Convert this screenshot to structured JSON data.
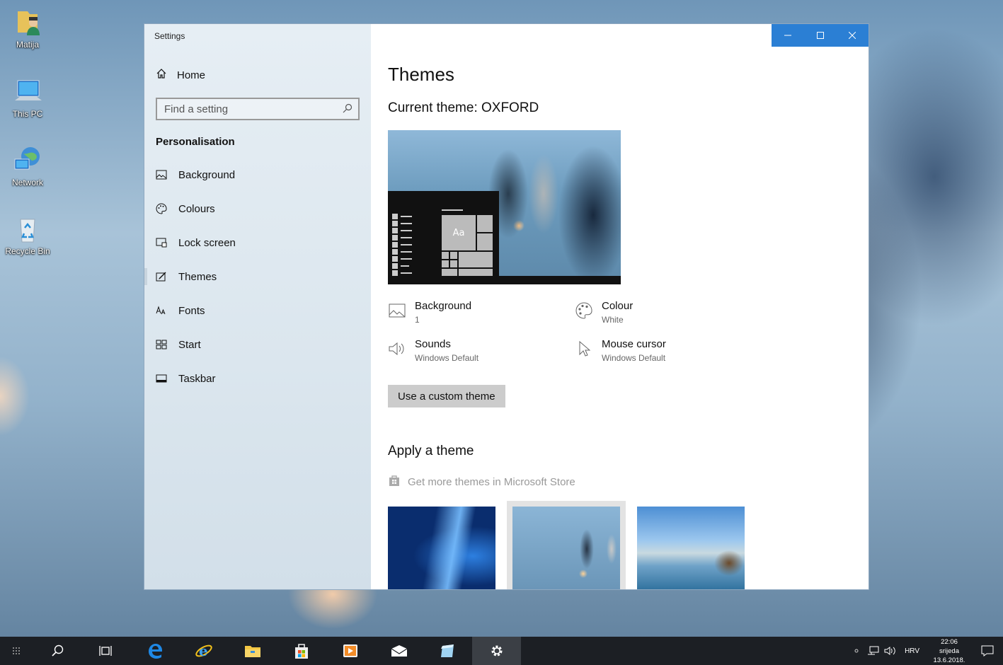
{
  "desktop": {
    "icons": [
      {
        "label": "Matija",
        "icon": "user-folder-icon"
      },
      {
        "label": "This PC",
        "icon": "computer-icon"
      },
      {
        "label": "Network",
        "icon": "network-icon"
      },
      {
        "label": "Recycle Bin",
        "icon": "recycle-bin-icon"
      }
    ]
  },
  "window": {
    "title": "Settings",
    "accent_color": "#2b7fd4"
  },
  "sidebar": {
    "home_label": "Home",
    "search_placeholder": "Find a setting",
    "section_title": "Personalisation",
    "items": [
      {
        "label": "Background",
        "icon": "picture-icon"
      },
      {
        "label": "Colours",
        "icon": "palette-icon"
      },
      {
        "label": "Lock screen",
        "icon": "lock-screen-icon"
      },
      {
        "label": "Themes",
        "icon": "themes-icon",
        "selected": true
      },
      {
        "label": "Fonts",
        "icon": "fonts-icon"
      },
      {
        "label": "Start",
        "icon": "start-icon"
      },
      {
        "label": "Taskbar",
        "icon": "taskbar-icon"
      }
    ]
  },
  "main": {
    "title": "Themes",
    "current_theme": "Current theme: OXFORD",
    "preview_tile_label": "Aa",
    "properties": [
      {
        "label": "Background",
        "value": "1",
        "icon": "picture-icon"
      },
      {
        "label": "Colour",
        "value": "White",
        "icon": "palette-icon"
      },
      {
        "label": "Sounds",
        "value": "Windows Default",
        "icon": "speaker-icon"
      },
      {
        "label": "Mouse cursor",
        "value": "Windows Default",
        "icon": "cursor-icon"
      }
    ],
    "custom_theme_button": "Use a custom theme",
    "apply_title": "Apply a theme",
    "store_link": "Get more themes in Microsoft Store",
    "themes": [
      {
        "name": "windows-10-theme",
        "selected": false
      },
      {
        "name": "oxford-theme",
        "selected": true
      },
      {
        "name": "beach-theme",
        "selected": false
      }
    ]
  },
  "taskbar": {
    "language": "HRV",
    "time": "22:06",
    "day": "srijeda",
    "date": "13.6.2018."
  }
}
